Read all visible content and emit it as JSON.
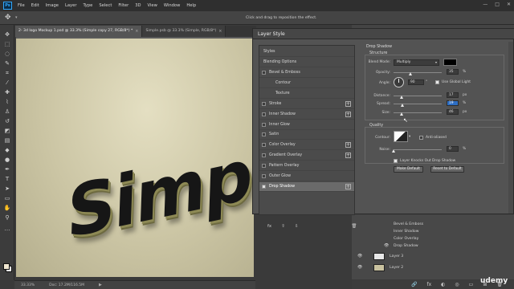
{
  "app": {
    "logo": "Ps"
  },
  "menu": [
    "File",
    "Edit",
    "Image",
    "Layer",
    "Type",
    "Select",
    "Filter",
    "3D",
    "View",
    "Window",
    "Help"
  ],
  "window_controls": {
    "minimize": "—",
    "maximize": "□",
    "close": "✕"
  },
  "options_bar": {
    "hint": "Click and drag to reposition the effect."
  },
  "tabs": [
    {
      "label": "2- 3d logo Mockup 1.psd @ 33.3% (Simple copy 27, RGB/8*) *",
      "close": "×"
    },
    {
      "label": "Simple.psb @ 33.3% (Simple, RGB/8*)",
      "close": "×"
    }
  ],
  "canvas": {
    "artwork_text": "Simple"
  },
  "status": {
    "zoom": "33.33%",
    "doc": "Doc: 17.2M/116.5M",
    "arrow": "▶"
  },
  "dialog": {
    "title": "Layer Style",
    "list": {
      "styles_header": "Styles",
      "blending_header": "Blending Options",
      "items": [
        {
          "label": "Bevel & Emboss",
          "plus": false
        },
        {
          "label": "Contour",
          "plus": false,
          "indent": true
        },
        {
          "label": "Texture",
          "plus": false,
          "indent": true
        },
        {
          "label": "Stroke",
          "plus": true
        },
        {
          "label": "Inner Shadow",
          "plus": true
        },
        {
          "label": "Inner Glow",
          "plus": false
        },
        {
          "label": "Satin",
          "plus": false
        },
        {
          "label": "Color Overlay",
          "plus": true
        },
        {
          "label": "Gradient Overlay",
          "plus": true
        },
        {
          "label": "Pattern Overlay",
          "plus": false
        },
        {
          "label": "Outer Glow",
          "plus": false
        },
        {
          "label": "Drop Shadow",
          "plus": true,
          "selected": true
        }
      ],
      "plus_glyph": "+",
      "footer": {
        "fx": "fx",
        "up": "⇧",
        "down": "⇩",
        "trash": "🗑"
      }
    },
    "drop_shadow": {
      "group_title": "Drop Shadow",
      "structure_title": "Structure",
      "blend_mode_label": "Blend Mode:",
      "blend_mode_value": "Multiply",
      "shadow_color": "#000000",
      "opacity_label": "Opacity:",
      "opacity_value": "35",
      "opacity_pct": 35,
      "angle_label": "Angle:",
      "angle_value": "90",
      "use_global_light_label": "Use Global Light",
      "use_global_light": true,
      "distance_label": "Distance:",
      "distance_value": "17",
      "distance_pct": 17,
      "spread_label": "Spread:",
      "spread_value": "19",
      "spread_pct": 19,
      "size_label": "Size:",
      "size_value": "46",
      "size_pct": 18,
      "unit_px": "px",
      "unit_pct": "%",
      "quality_title": "Quality",
      "contour_label": "Contour:",
      "anti_aliased_label": "Anti-aliased",
      "noise_label": "Noise:",
      "noise_value": "0",
      "noise_pct": 0,
      "knocks_out_label": "Layer Knocks Out Drop Shadow",
      "knocks_out": true,
      "make_default_label": "Make Default",
      "reset_default_label": "Reset to Default",
      "degree_sign": "°"
    }
  },
  "layers_panel": {
    "effects": [
      "Bevel & Emboss",
      "Inner Shadow",
      "Color Overlay",
      "Drop Shadow"
    ],
    "layers": [
      {
        "name": "Layer 3",
        "thumb": "#e8e8e8"
      },
      {
        "name": "Layer 2",
        "thumb": "#c9c29f"
      }
    ],
    "eye_glyph": "👁",
    "footer_icons": [
      "🔗",
      "fx",
      "◐",
      "◎",
      "▭",
      "⊞",
      "🗑"
    ]
  },
  "watermark": "udemy"
}
